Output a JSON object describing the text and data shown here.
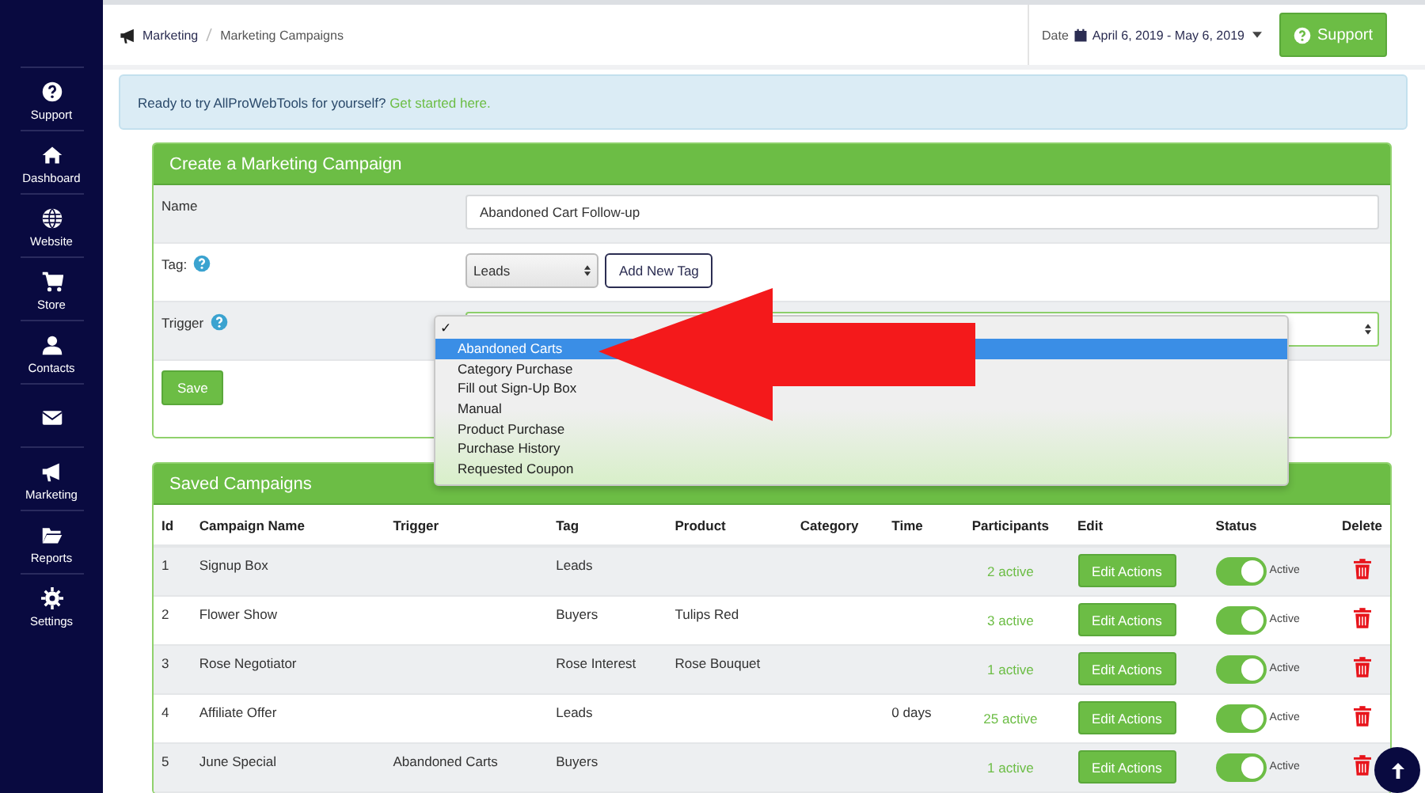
{
  "sidebar": {
    "items": [
      {
        "kind": "labeled",
        "label": "Support"
      },
      {
        "kind": "labeled",
        "label": "Dashboard"
      },
      {
        "kind": "labeled",
        "label": "Website"
      },
      {
        "kind": "labeled",
        "label": "Store"
      },
      {
        "kind": "labeled",
        "label": "Contacts"
      },
      {
        "kind": "icon_only"
      },
      {
        "kind": "labeled",
        "label": "Marketing"
      },
      {
        "kind": "labeled",
        "label": "Reports"
      },
      {
        "kind": "labeled",
        "label": "Settings"
      }
    ]
  },
  "breadcrumb": [
    "Marketing",
    "Marketing Campaigns"
  ],
  "date_range": {
    "label": "Date",
    "value": "April 6, 2019 - May 6, 2019"
  },
  "support_button": "Support",
  "alert": {
    "text": "Ready to try AllProWebTools for yourself?",
    "link": "Get started here."
  },
  "create_panel": {
    "title": "Create a Marketing Campaign",
    "name": {
      "label": "Name",
      "value": "Abandoned Cart Follow-up"
    },
    "tag": {
      "label": "Tag:",
      "value": "Leads",
      "add_button": "Add New Tag"
    },
    "trigger": {
      "label": "Trigger",
      "dropdown": {
        "check_mark": "✓",
        "options": [
          {
            "label": "Abandoned Carts",
            "selected": true
          },
          {
            "label": "Category Purchase",
            "selected": false
          },
          {
            "label": "Fill out Sign-Up Box",
            "selected": false
          },
          {
            "label": "Manual",
            "selected": false
          },
          {
            "label": "Product Purchase",
            "selected": false
          },
          {
            "label": "Purchase History",
            "selected": false
          },
          {
            "label": "Requested Coupon",
            "selected": false
          }
        ]
      }
    },
    "save_button": "Save"
  },
  "saved_panel": {
    "title": "Saved Campaigns",
    "columns": [
      "Id",
      "Campaign Name",
      "Trigger",
      "Tag",
      "Product",
      "Category",
      "Time",
      "Participants",
      "Edit",
      "Status",
      "Delete"
    ],
    "rows": [
      {
        "id": "1",
        "name": "Signup Box",
        "tag": "Leads",
        "participants": "2 active",
        "edit": "Edit Actions",
        "status": "Active",
        "on": true
      },
      {
        "id": "2",
        "name": "Flower Show",
        "tag": "Buyers",
        "product": "Tulips Red",
        "participants": "3 active",
        "edit": "Edit Actions",
        "status": "Active",
        "on": true
      },
      {
        "id": "3",
        "name": "Rose Negotiator",
        "tag": "Rose Interest",
        "product": "Rose Bouquet",
        "participants": "1 active",
        "edit": "Edit Actions",
        "status": "Active",
        "on": true
      },
      {
        "id": "4",
        "name": "Affiliate Offer",
        "tag": "Leads",
        "time": "0 days",
        "participants": "25 active",
        "edit": "Edit Actions",
        "status": "Active",
        "on": true
      },
      {
        "id": "5",
        "name": "June Special",
        "trigger": "Abandoned Carts",
        "tag": "Buyers",
        "participants": "1 active",
        "edit": "Edit Actions",
        "status": "Active",
        "on": true
      }
    ]
  }
}
